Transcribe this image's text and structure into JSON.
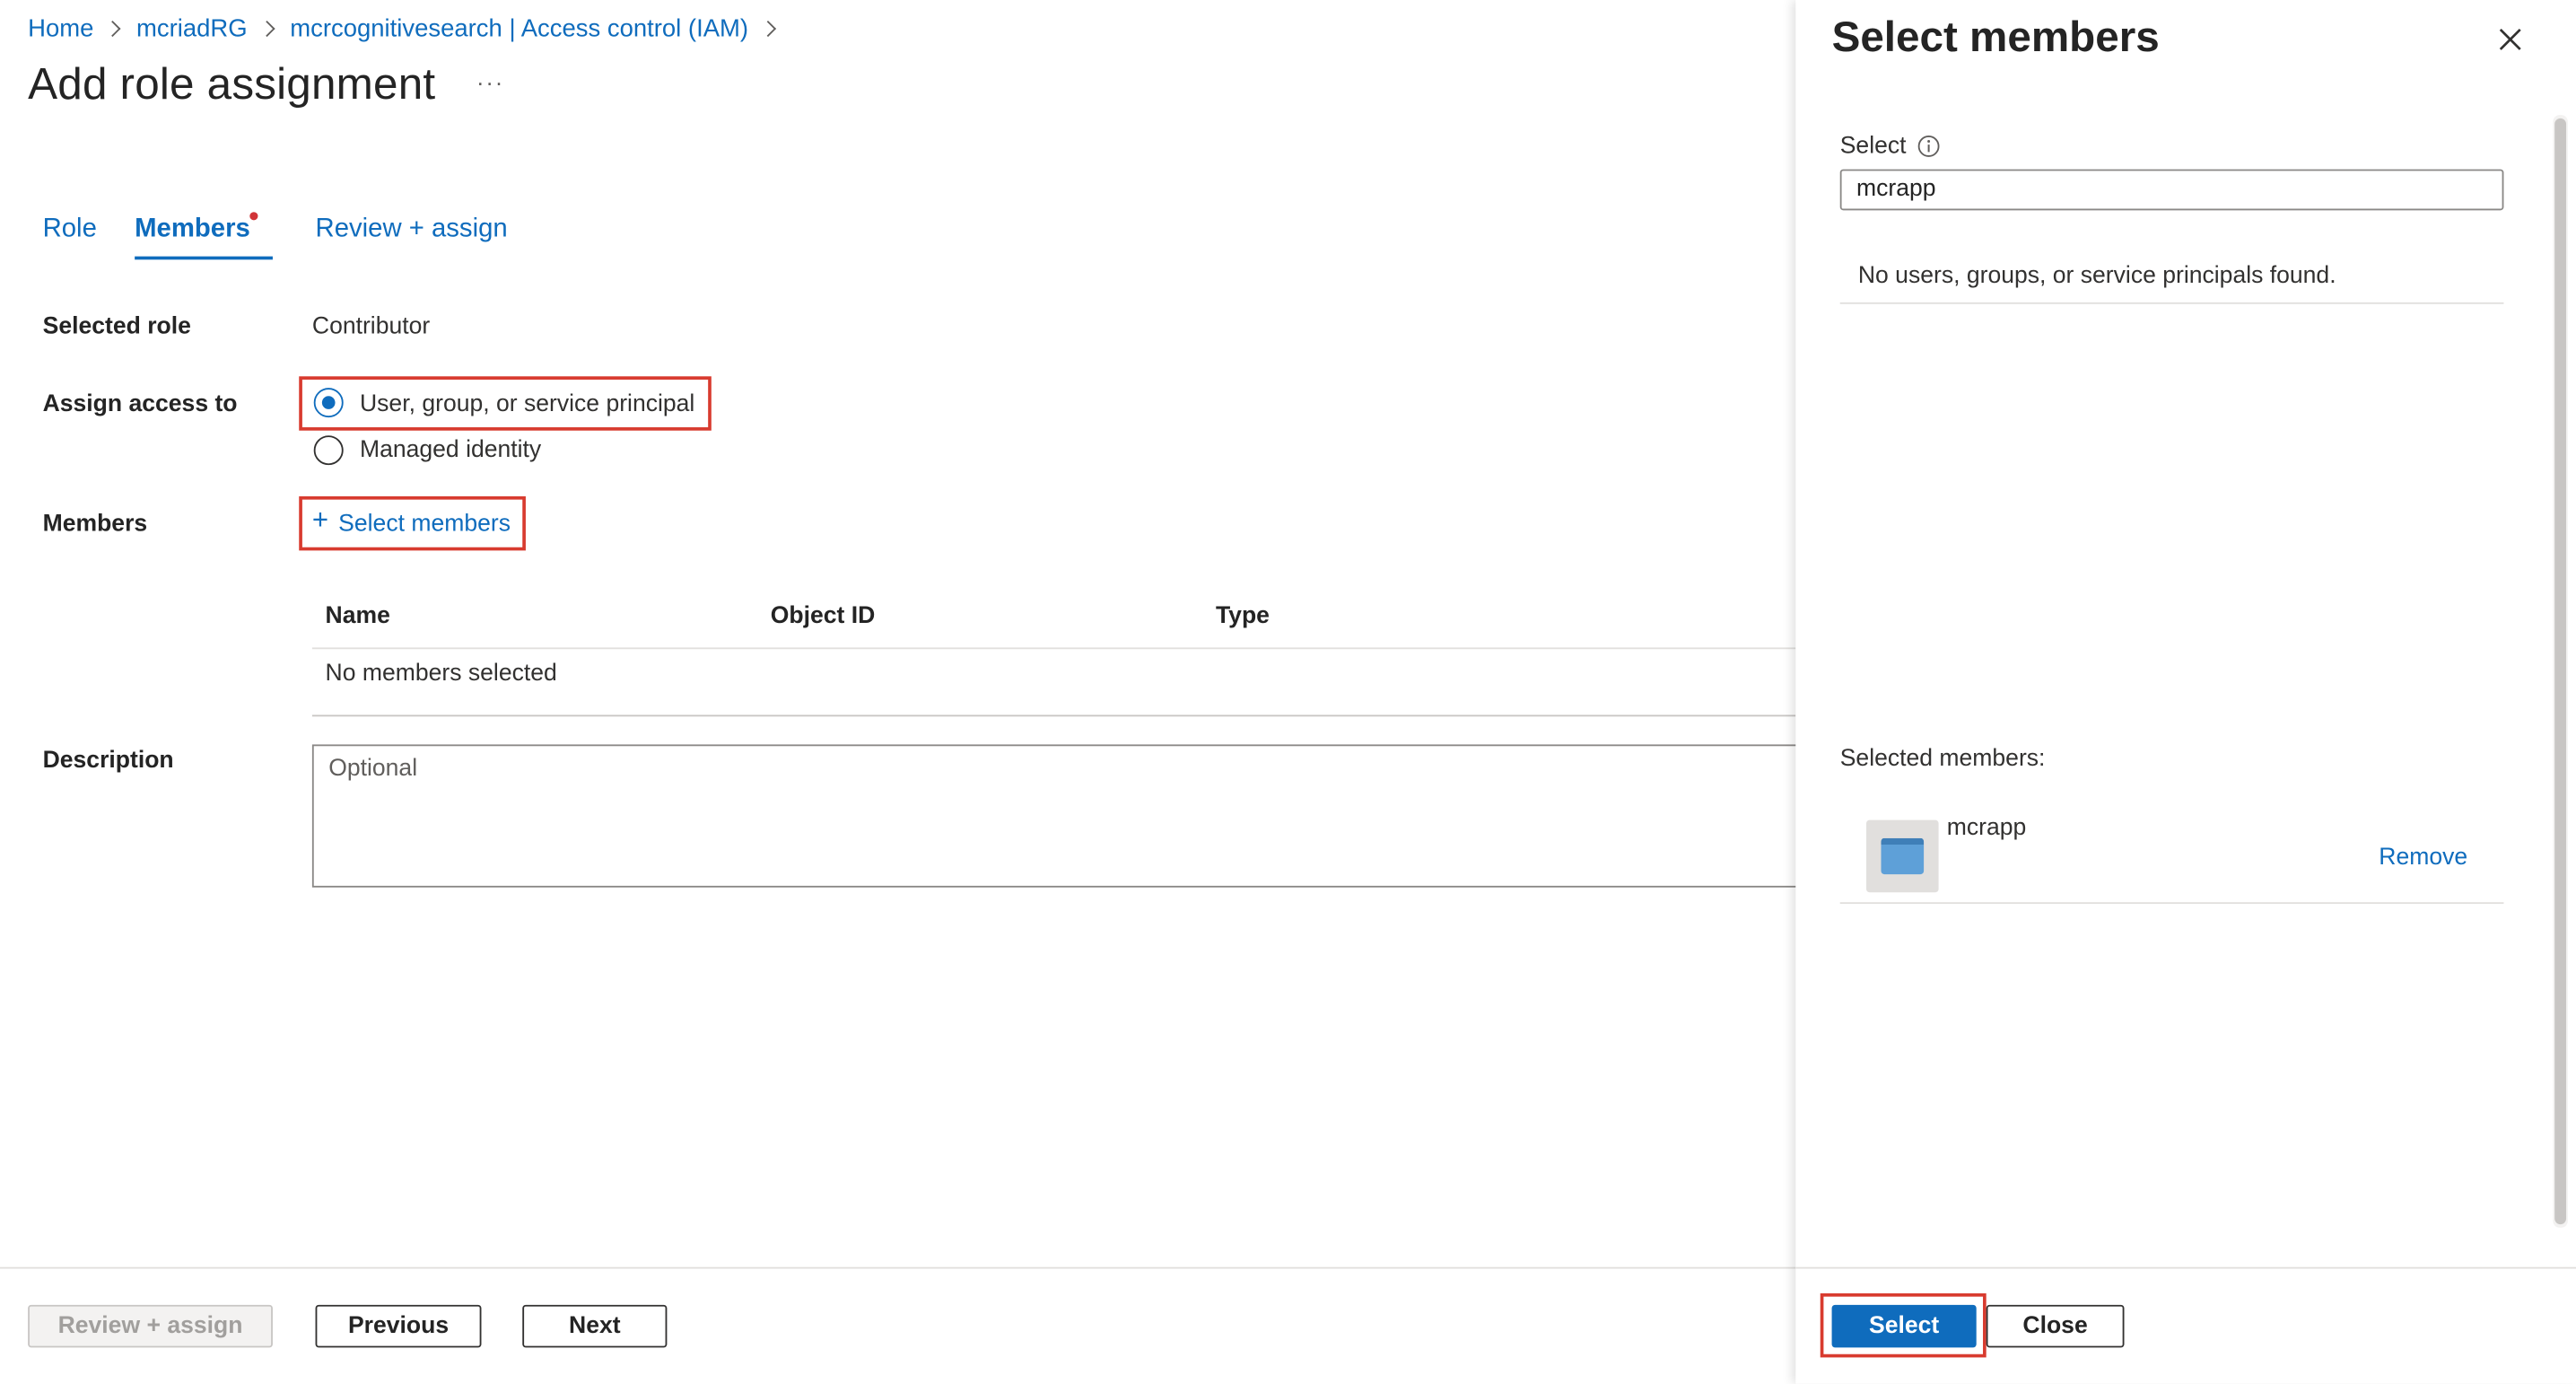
{
  "breadcrumb": {
    "items": [
      "Home",
      "mcriadRG",
      "mcrcognitivesearch | Access control (IAM)"
    ]
  },
  "page": {
    "title": "Add role assignment",
    "more_label": "···"
  },
  "tabs": [
    {
      "label": "Role"
    },
    {
      "label": "Members"
    },
    {
      "label": "Review + assign"
    }
  ],
  "form": {
    "selected_role_label": "Selected role",
    "selected_role_value": "Contributor",
    "assign_access_label": "Assign access to",
    "assign_options": [
      "User, group, or service principal",
      "Managed identity"
    ],
    "members_label": "Members",
    "select_members_link": "Select members",
    "table_headers": [
      "Name",
      "Object ID",
      "Type"
    ],
    "no_members_text": "No members selected",
    "description_label": "Description",
    "description_placeholder": "Optional"
  },
  "footer": {
    "review_assign": "Review + assign",
    "previous": "Previous",
    "next": "Next"
  },
  "panel": {
    "title": "Select members",
    "select_label": "Select",
    "search_value": "mcrapp",
    "no_results_text": "No users, groups, or service principals found.",
    "selected_members_label": "Selected members:",
    "selected_member_name": "mcrapp",
    "remove_label": "Remove",
    "select_button": "Select",
    "close_button": "Close"
  },
  "colors": {
    "accent": "#0f6cbd",
    "highlight": "#d83b2f",
    "required_dot": "#d13438"
  },
  "icons": [
    "chevron-right-icon",
    "more-icon",
    "info-icon",
    "plus-icon",
    "close-icon",
    "app-icon"
  ]
}
